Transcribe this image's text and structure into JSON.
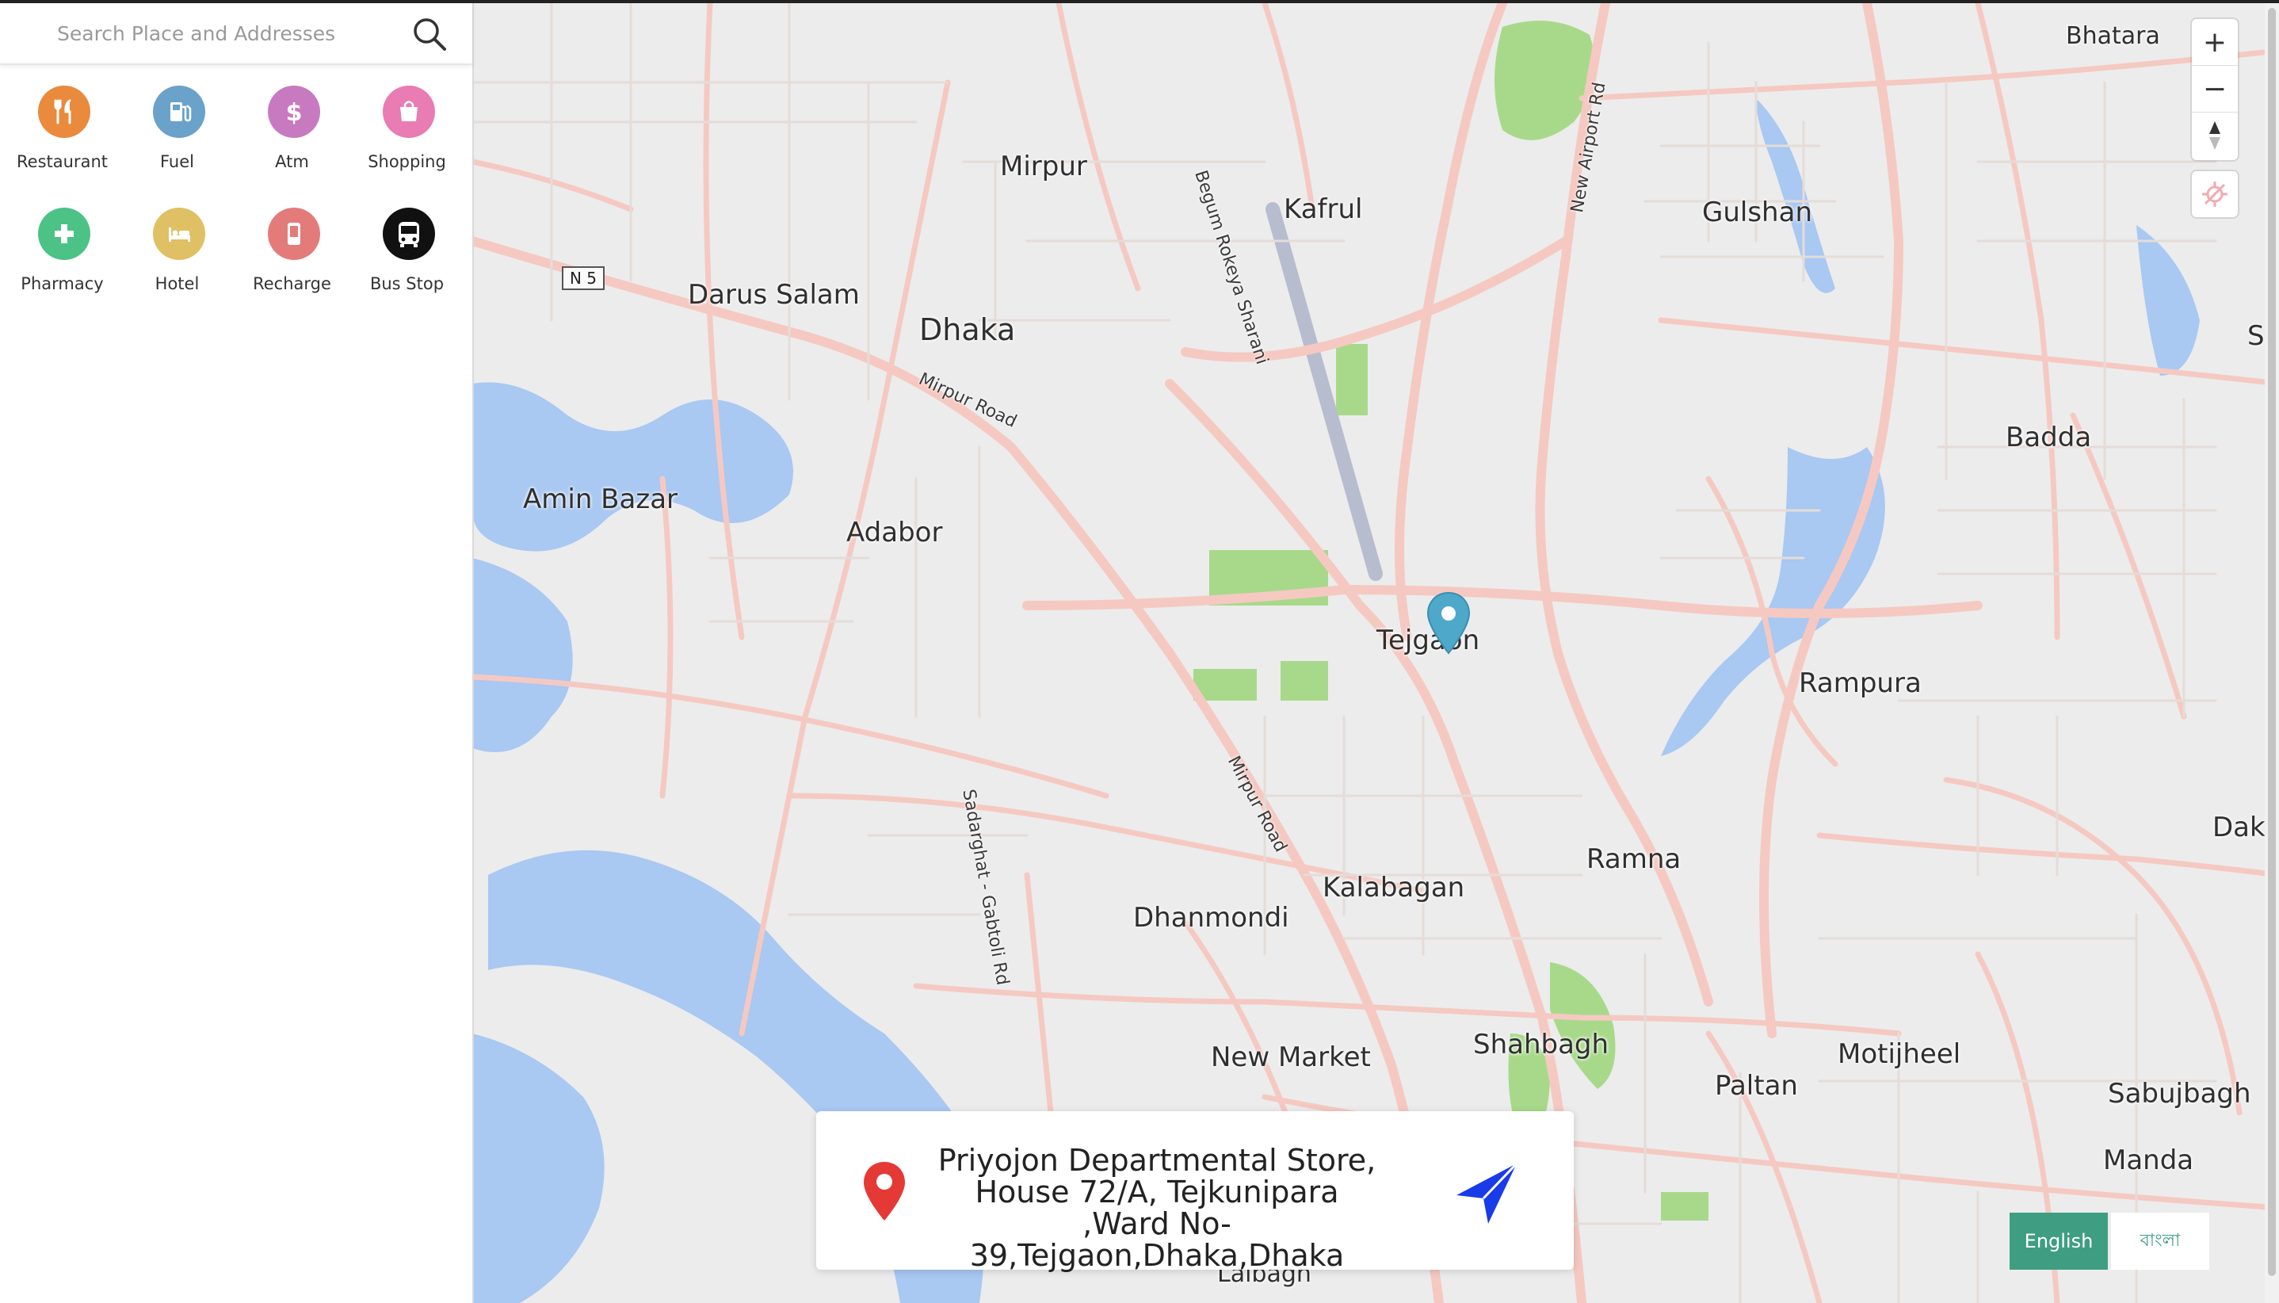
{
  "search": {
    "placeholder": "Search Place and Addresses",
    "icon": "search-icon"
  },
  "categories": [
    {
      "label": "Restaurant",
      "icon": "restaurant-icon",
      "color": "#e98a3c"
    },
    {
      "label": "Fuel",
      "icon": "fuel-icon",
      "color": "#6aa2c9"
    },
    {
      "label": "Atm",
      "icon": "atm-icon",
      "color": "#c87ac0"
    },
    {
      "label": "Shopping",
      "icon": "shopping-icon",
      "color": "#e87cb3"
    },
    {
      "label": "Pharmacy",
      "icon": "pharmacy-icon",
      "color": "#4cc286"
    },
    {
      "label": "Hotel",
      "icon": "hotel-icon",
      "color": "#e0c064"
    },
    {
      "label": "Recharge",
      "icon": "recharge-icon",
      "color": "#e47b7b"
    },
    {
      "label": "Bus Stop",
      "icon": "bus-icon",
      "color": "#111111"
    }
  ],
  "map": {
    "places": [
      "Bhatara",
      "Mirpur",
      "Kafrul",
      "Gulshan",
      "Darus Salam",
      "Dhaka",
      "Badda",
      "Amin Bazar",
      "Adabor",
      "Tejgaon",
      "Rampura",
      "Ramna",
      "Kalabagan",
      "Dhanmondi",
      "Shahbagh",
      "Motijheel",
      "Paltan",
      "New Market",
      "Sabujbagh",
      "Manda",
      "Lalbagh",
      "Dak",
      "S"
    ],
    "roads": [
      "Begum Rokeya Sharani",
      "New Airport Rd",
      "Mirpur Road",
      "Mirpur Road",
      "Sadarghat - Gabtoli Rd"
    ],
    "highway_shield": "N 5",
    "colors": {
      "land": "#ececec",
      "road": "#f5c9c2",
      "water": "#a9c8f2",
      "park": "#a8d98a"
    }
  },
  "controls": {
    "zoom_in": "+",
    "zoom_out": "−"
  },
  "address_card": {
    "text": "Priyojon Departmental Store, House 72/A, Tejkunipara ,Ward No-39,Tejgaon,Dhaka,Dhaka"
  },
  "language": {
    "english": "English",
    "bangla": "বাংলা",
    "active_color": "#3f9e82"
  }
}
